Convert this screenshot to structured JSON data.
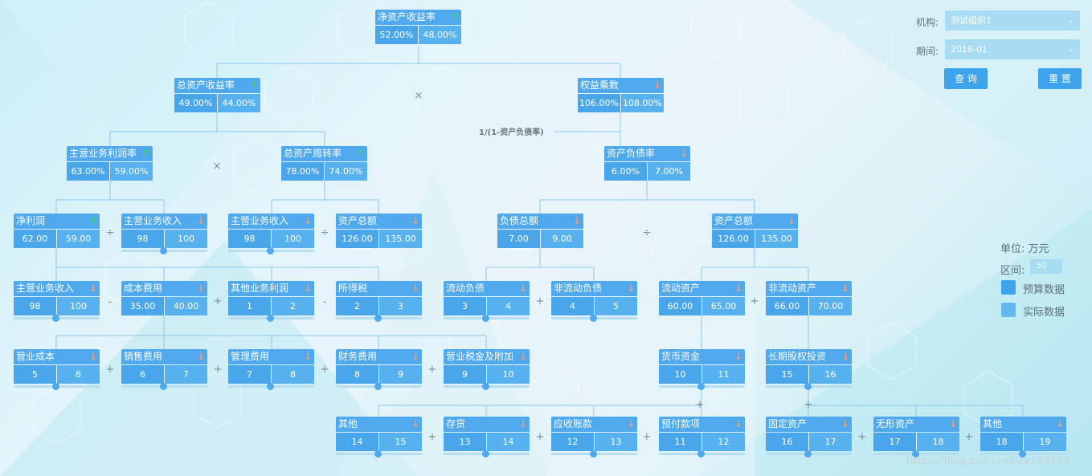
{
  "formula_label": "1/(1-资产负债率)",
  "operators": {
    "times1": "×",
    "times2": "×",
    "div1": "÷",
    "div2": "÷",
    "div3": "÷",
    "minus1": "-",
    "minus2": "-",
    "plus1": "+",
    "plus2": "+",
    "plus3": "+",
    "plus4": "+",
    "plus5": "+",
    "plus6": "+",
    "plus7": "+",
    "plus8": "+",
    "plus9": "+",
    "plus10": "+",
    "plus11": "+",
    "plus12": "+",
    "plus13": "+",
    "plus14": "+"
  },
  "controls": {
    "org_label": "机构:",
    "org_value": "测试组织1",
    "period_label": "期间:",
    "period_value": "2016-01",
    "query_button": "查 询",
    "reset_button": "重 置"
  },
  "legend": {
    "unit_label": "单位: 万元",
    "range_label": "区间:",
    "range_value": "50",
    "budget_label": "预算数据",
    "actual_label": "实际数据",
    "budget_color": "#3ea3ea",
    "actual_color": "#63b8f0"
  },
  "watermark": "https://blog.csdn.net/zy103118",
  "nodes": {
    "roe": {
      "title": "净资产收益率",
      "trend": "up",
      "budget": "52.00%",
      "actual": "48.00%"
    },
    "roa": {
      "title": "总资产收益率",
      "trend": "up",
      "budget": "49.00%",
      "actual": "44.00%"
    },
    "equity_mult": {
      "title": "权益乘数",
      "trend": "down",
      "budget": "106.00%",
      "actual": "108.00%"
    },
    "main_margin": {
      "title": "主营业务利润率",
      "trend": "up",
      "budget": "63.00%",
      "actual": "59.00%"
    },
    "asset_turn": {
      "title": "总资产周转率",
      "trend": "up",
      "budget": "78.00%",
      "actual": "74.00%"
    },
    "debt_ratio": {
      "title": "资产负债率",
      "trend": "down",
      "budget": "6.00%",
      "actual": "7.00%"
    },
    "net_profit": {
      "title": "净利润",
      "trend": "up",
      "budget": "62.00",
      "actual": "59.00"
    },
    "main_rev1": {
      "title": "主营业务收入",
      "trend": "down",
      "budget": "98",
      "actual": "100",
      "slider": true
    },
    "main_rev2": {
      "title": "主营业务收入",
      "trend": "down",
      "budget": "98",
      "actual": "100",
      "slider": true
    },
    "total_assets1": {
      "title": "资产总额",
      "trend": "down",
      "budget": "126.00",
      "actual": "135.00"
    },
    "total_debt": {
      "title": "负债总额",
      "trend": "down",
      "budget": "7.00",
      "actual": "9.00"
    },
    "total_assets2": {
      "title": "资产总额",
      "trend": "down",
      "budget": "126.00",
      "actual": "135.00"
    },
    "main_rev3": {
      "title": "主营业务收入",
      "trend": "down",
      "budget": "98",
      "actual": "100",
      "slider": true
    },
    "cost": {
      "title": "成本费用",
      "trend": "down",
      "budget": "35.00",
      "actual": "40.00"
    },
    "other_profit": {
      "title": "其他业务利润",
      "trend": "down",
      "budget": "1",
      "actual": "2",
      "slider": true
    },
    "income_tax": {
      "title": "所得税",
      "trend": "down",
      "budget": "2",
      "actual": "3",
      "slider": true
    },
    "current_liab": {
      "title": "流动负债",
      "trend": "down",
      "budget": "3",
      "actual": "4",
      "slider": true
    },
    "noncur_liab": {
      "title": "非流动负债",
      "trend": "down",
      "budget": "4",
      "actual": "5",
      "slider": true
    },
    "current_assets": {
      "title": "流动资产",
      "trend": "down",
      "budget": "60.00",
      "actual": "65.00"
    },
    "noncur_assets": {
      "title": "非流动资产",
      "trend": "down",
      "budget": "66.00",
      "actual": "70.00"
    },
    "op_cost": {
      "title": "营业成本",
      "trend": "down",
      "budget": "5",
      "actual": "6",
      "slider": true
    },
    "sales_exp": {
      "title": "销售费用",
      "trend": "down",
      "budget": "6",
      "actual": "7",
      "slider": true
    },
    "admin_exp": {
      "title": "管理费用",
      "trend": "down",
      "budget": "7",
      "actual": "8",
      "slider": true
    },
    "fin_exp": {
      "title": "财务费用",
      "trend": "down",
      "budget": "8",
      "actual": "9",
      "slider": true
    },
    "biz_tax": {
      "title": "营业税金及附加",
      "trend": "down",
      "budget": "9",
      "actual": "10",
      "slider": true
    },
    "cash": {
      "title": "货币资金",
      "trend": "down",
      "budget": "10",
      "actual": "11",
      "slider": true
    },
    "lt_equity": {
      "title": "长期股权投资",
      "trend": "down",
      "budget": "15",
      "actual": "16",
      "slider": true
    },
    "other": {
      "title": "其他",
      "trend": "down",
      "budget": "14",
      "actual": "15",
      "slider": true
    },
    "inventory": {
      "title": "存货",
      "trend": "down",
      "budget": "13",
      "actual": "14",
      "slider": true
    },
    "receivable": {
      "title": "应收账款",
      "trend": "down",
      "budget": "12",
      "actual": "13",
      "slider": true
    },
    "prepaid": {
      "title": "预付款项",
      "trend": "down",
      "budget": "11",
      "actual": "12",
      "slider": true
    },
    "fixed_assets": {
      "title": "固定资产",
      "trend": "down",
      "budget": "16",
      "actual": "17",
      "slider": true
    },
    "intangible": {
      "title": "无形资产",
      "trend": "down",
      "budget": "17",
      "actual": "18",
      "slider": true
    },
    "other2": {
      "title": "其他",
      "trend": "down",
      "budget": "18",
      "actual": "19",
      "slider": true
    }
  }
}
